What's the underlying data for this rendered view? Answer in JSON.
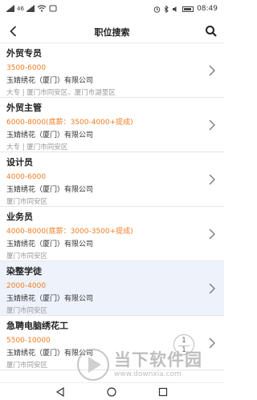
{
  "status_bar": {
    "signal": "46",
    "time": "08:49"
  },
  "nav": {
    "title": "职位搜索"
  },
  "jobs": [
    {
      "title": "外贸专员",
      "salary": "3500-6000",
      "company": "玉婧绣花（厦门）有限公司",
      "meta": "大专 | 厦门市同安区、厦门市湖里区"
    },
    {
      "title": "外贸主管",
      "salary": "6000-8000(底薪：3500-4000+提成)",
      "company": "玉婧绣花（厦门）有限公司",
      "meta": "大专 | 厦门市同安区"
    },
    {
      "title": "设计员",
      "salary": "4000-6000",
      "company": "玉婧绣花（厦门）有限公司",
      "meta": "厦门市同安区"
    },
    {
      "title": "业务员",
      "salary": "4000-8000(底薪：3000-3500+提成)",
      "company": "玉婧绣花（厦门）有限公司",
      "meta": "厦门市同安区"
    },
    {
      "title": "染整学徒",
      "salary": "2000-4000",
      "company": "玉婧绣花（厦门）有限公司",
      "meta": "厦门市同安区"
    },
    {
      "title": "急聘电脑绣花工",
      "salary": "5500-10000",
      "company": "玉婧绣花（厦门）有限公司",
      "meta": "厦门市同安区"
    }
  ],
  "page_badge": {
    "current": "1",
    "total": "1"
  },
  "watermark": {
    "name": "当下软件园",
    "url": "www.downxia.com"
  }
}
